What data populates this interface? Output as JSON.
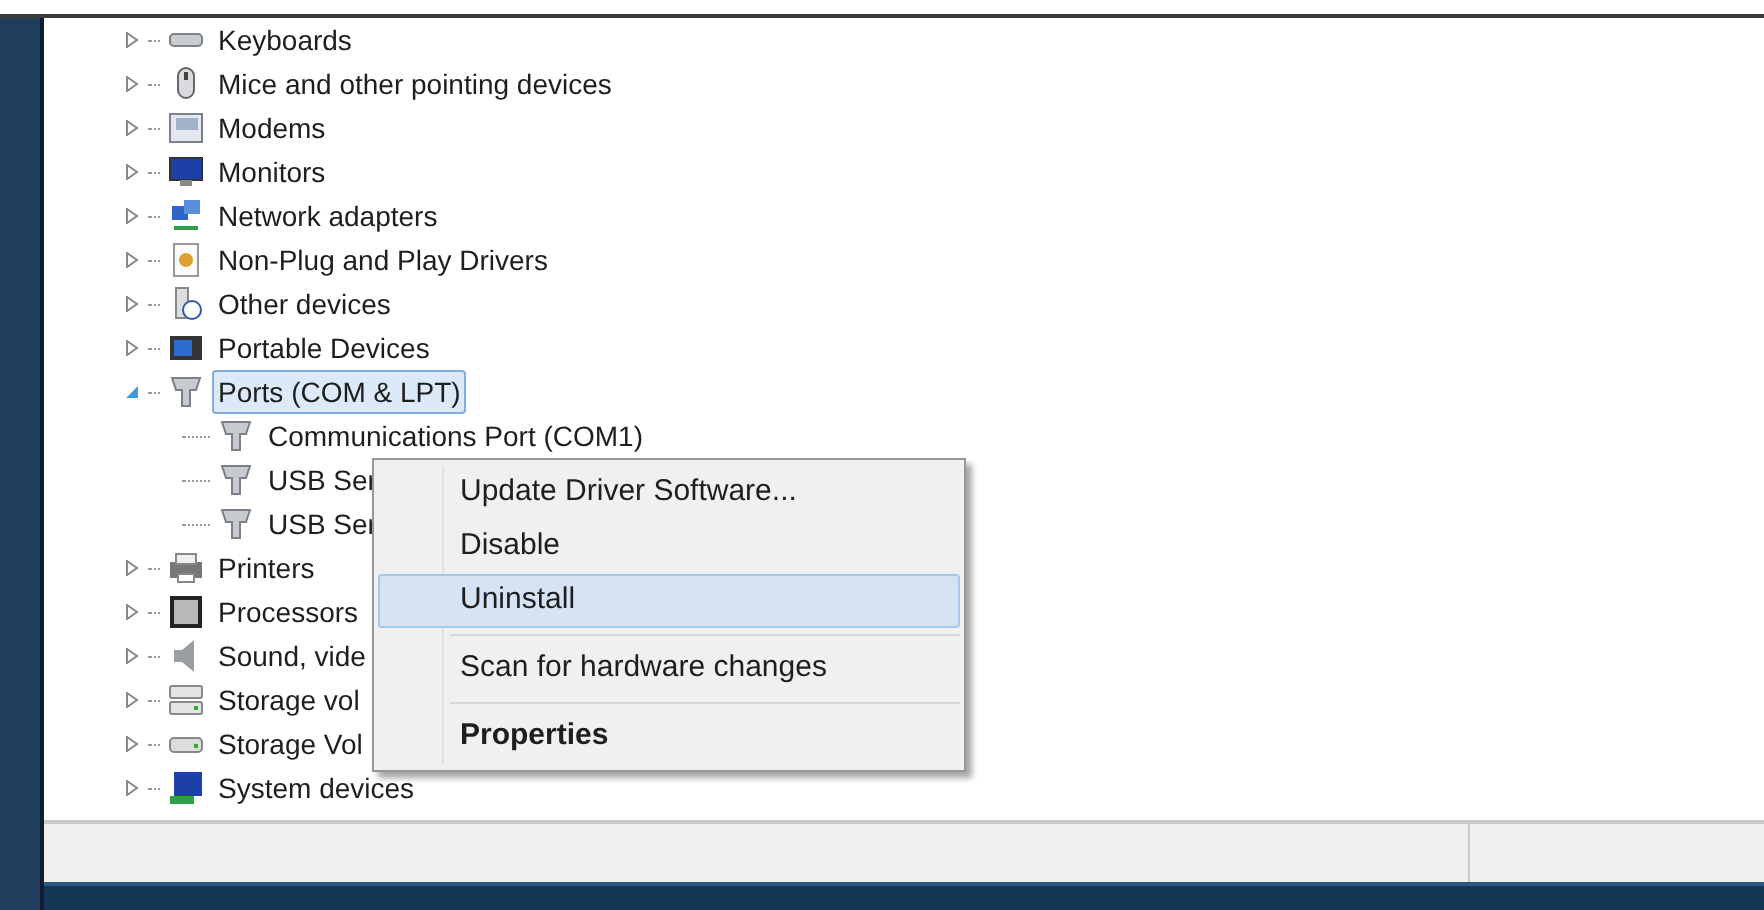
{
  "tree": {
    "items": [
      {
        "label": "Keyboards",
        "kind": "keyboard",
        "expanded": false,
        "selected": false
      },
      {
        "label": "Mice and other pointing devices",
        "kind": "mouse",
        "expanded": false,
        "selected": false
      },
      {
        "label": "Modems",
        "kind": "modem",
        "expanded": false,
        "selected": false
      },
      {
        "label": "Monitors",
        "kind": "monitor",
        "expanded": false,
        "selected": false
      },
      {
        "label": "Network adapters",
        "kind": "network",
        "expanded": false,
        "selected": false
      },
      {
        "label": "Non-Plug and Play Drivers",
        "kind": "driver",
        "expanded": false,
        "selected": false
      },
      {
        "label": "Other devices",
        "kind": "other",
        "expanded": false,
        "selected": false
      },
      {
        "label": "Portable Devices",
        "kind": "portable",
        "expanded": false,
        "selected": false
      },
      {
        "label": "Ports (COM & LPT)",
        "kind": "port",
        "expanded": true,
        "selected": true,
        "children": [
          {
            "label": "Communications Port (COM1)",
            "kind": "port",
            "selected": false
          },
          {
            "label": "USB Ser",
            "kind": "port",
            "selected": false
          },
          {
            "label": "USB Ser",
            "kind": "port",
            "selected": false
          }
        ]
      },
      {
        "label": "Printers",
        "kind": "printer",
        "expanded": false,
        "selected": false
      },
      {
        "label": "Processors",
        "kind": "processor",
        "expanded": false,
        "selected": false
      },
      {
        "label": "Sound, vide",
        "kind": "sound",
        "expanded": false,
        "selected": false
      },
      {
        "label": "Storage vol",
        "kind": "storage",
        "expanded": false,
        "selected": false
      },
      {
        "label": "Storage Vol",
        "kind": "drive",
        "expanded": false,
        "selected": false
      },
      {
        "label": "System devices",
        "kind": "system",
        "expanded": false,
        "selected": false
      }
    ]
  },
  "context_menu": {
    "items": [
      {
        "kind": "item",
        "label": "Update Driver Software...",
        "selected": false,
        "default": false
      },
      {
        "kind": "item",
        "label": "Disable",
        "selected": false,
        "default": false
      },
      {
        "kind": "item",
        "label": "Uninstall",
        "selected": true,
        "default": false
      },
      {
        "kind": "separator"
      },
      {
        "kind": "item",
        "label": "Scan for hardware changes",
        "selected": false,
        "default": false
      },
      {
        "kind": "separator"
      },
      {
        "kind": "item",
        "label": "Properties",
        "selected": false,
        "default": true
      }
    ]
  }
}
